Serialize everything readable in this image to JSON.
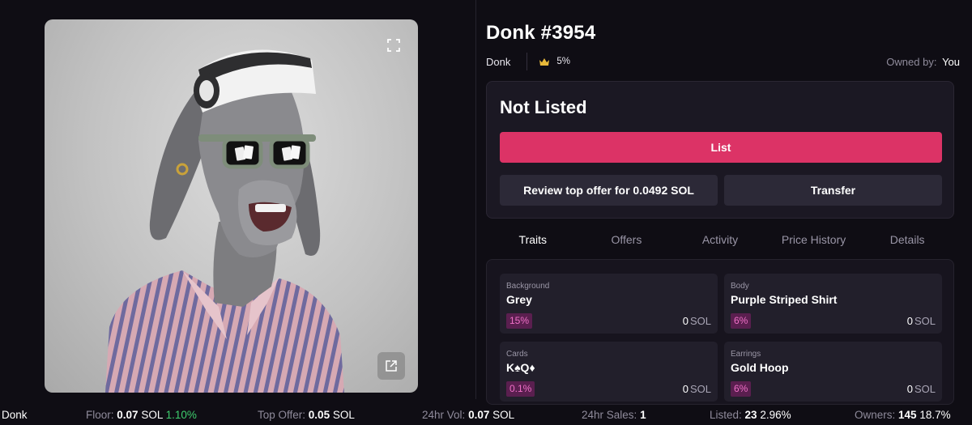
{
  "nft": {
    "title": "Donk #3954",
    "collection": "Donk",
    "rank_percent": "5%",
    "owned_by_label": "Owned by:",
    "owner": "You"
  },
  "listing": {
    "status": "Not Listed",
    "list_label": "List",
    "review_offer_label": "Review top offer for 0.0492 SOL",
    "transfer_label": "Transfer"
  },
  "tabs": [
    "Traits",
    "Offers",
    "Activity",
    "Price History",
    "Details"
  ],
  "active_tab": "Traits",
  "traits": [
    {
      "type": "Background",
      "value": "Grey",
      "percent": "15%",
      "price": "0",
      "unit": "SOL"
    },
    {
      "type": "Body",
      "value": "Purple Striped Shirt",
      "percent": "6%",
      "price": "0",
      "unit": "SOL"
    },
    {
      "type": "Cards",
      "value": "K♠Q♦",
      "percent": "0.1%",
      "price": "0",
      "unit": "SOL"
    },
    {
      "type": "Earrings",
      "value": "Gold Hoop",
      "percent": "6%",
      "price": "0",
      "unit": "SOL"
    }
  ],
  "stats": {
    "collection": "Donk",
    "floor_label": "Floor:",
    "floor_value": "0.07",
    "floor_unit": "SOL",
    "floor_change": "1.10%",
    "top_offer_label": "Top Offer:",
    "top_offer_value": "0.05",
    "top_offer_unit": "SOL",
    "vol_label": "24hr Vol:",
    "vol_value": "0.07",
    "vol_unit": "SOL",
    "sales_label": "24hr Sales:",
    "sales_value": "1",
    "listed_label": "Listed:",
    "listed_value": "23",
    "listed_pct": "2.96%",
    "owners_label": "Owners:",
    "owners_value": "145",
    "owners_pct": "18.7%"
  },
  "icons": {
    "expand": "expand-icon",
    "open_external": "external-link-icon",
    "rank": "crown-icon"
  },
  "colors": {
    "accent": "#dc3366",
    "positive": "#3ecf6e",
    "trait_badge_bg": "#5a1f4f",
    "trait_badge_text": "#f070c8",
    "background": "#0f0d14",
    "crown": "#e8b93a"
  }
}
